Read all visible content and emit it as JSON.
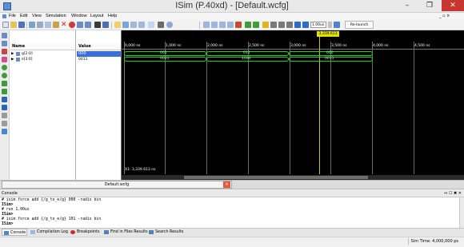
{
  "window": {
    "title": "ISim (P.40xd) - [Default.wcfg]",
    "controls": {
      "minimize": "–",
      "maximize": "❐",
      "close": "✕"
    }
  },
  "menu": [
    "File",
    "Edit",
    "View",
    "Simulation",
    "Window",
    "Layout",
    "Help"
  ],
  "toolbar": {
    "run_time": "1.00us",
    "relaunch_label": "Re-launch"
  },
  "waveform": {
    "columns": {
      "name": "Name",
      "value": "Value"
    },
    "signals": [
      {
        "name": "g[2:0]",
        "value": "000",
        "segments": [
          "001",
          "011",
          "000"
        ]
      },
      {
        "name": "e[3:0]",
        "value": "0011",
        "segments": [
          "0011",
          "1000",
          "0011"
        ]
      }
    ],
    "time_ticks": [
      "0,000 ns",
      "1,000 ns",
      "2,000 ns",
      "2,500 ns",
      "3,000 ns",
      "3,500 ns",
      "4,000 ns",
      "4,500 ns"
    ],
    "cursor_label": "3,339.613 ns",
    "cursor_readout": "X1: 3,339.613 ns",
    "colors": {
      "background": "#000000",
      "bus": "#1fd11f",
      "cursor": "#c9c800"
    }
  },
  "doc_tab": {
    "label": "Default.wcfg"
  },
  "console": {
    "title": "Console",
    "header_buttons": "↔ ☐ ✖ ✕",
    "lines": [
      "# isim force add {/g_to_e/g} 000 -radix bin",
      "ISim>",
      "# run 1.00us",
      "ISim>",
      "# isim force add {/g_to_e/g} 101 -radix bin",
      "ISim>"
    ]
  },
  "bottom_tabs": [
    "Console",
    "Compilation Log",
    "Breakpoints",
    "Find in Files Results",
    "Search Results"
  ],
  "status": {
    "sim_time": "Sim Time: 4,000,000 ps"
  }
}
